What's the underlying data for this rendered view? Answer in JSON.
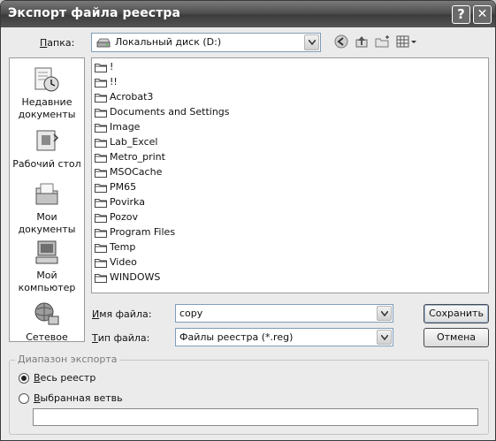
{
  "window": {
    "title": "Экспорт файла реестра",
    "help_button": "?",
    "close_button": "✕"
  },
  "lookin": {
    "label_u": "П",
    "label_rest": "апка:",
    "value": "Локальный диск (D:)"
  },
  "places": [
    {
      "name": "recent-documents",
      "label1": "Недавние",
      "label2": "документы"
    },
    {
      "name": "desktop",
      "label1": "Рабочий стол",
      "label2": ""
    },
    {
      "name": "my-documents",
      "label1": "Мои документы",
      "label2": ""
    },
    {
      "name": "my-computer",
      "label1": "Мой",
      "label2": "компьютер"
    },
    {
      "name": "network",
      "label1": "Сетевое",
      "label2": ""
    }
  ],
  "files": [
    "!",
    "!!",
    "Acrobat3",
    "Documents and Settings",
    "Image",
    "Lab_Excel",
    "Metro_print",
    "MSOCache",
    "PM65",
    "Povirka",
    "Pozov",
    "Program Files",
    "Temp",
    "Video",
    "WINDOWS"
  ],
  "filename": {
    "label_u": "И",
    "label_rest": "мя файла:",
    "value": "copy"
  },
  "filetype": {
    "label_u": "Т",
    "label_rest": "ип файла:",
    "value": "Файлы реестра (*.reg)"
  },
  "buttons": {
    "save": "Сохранить",
    "cancel": "Отмена"
  },
  "export_range": {
    "title": "Диапазон экспорта",
    "all_u": "В",
    "all_rest": "есь реестр",
    "branch_u": "В",
    "branch_rest": "ыбранная ветвь",
    "selected": "all",
    "branch_value": ""
  }
}
